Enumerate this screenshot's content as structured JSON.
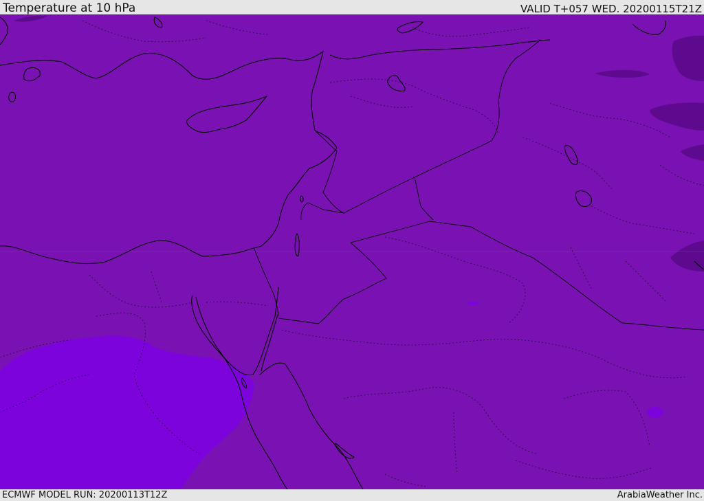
{
  "header": {
    "title": "Temperature at 10 hPa",
    "valid_time": "VALID T+057 WED. 20200115T21Z"
  },
  "footer": {
    "model_run": "ECMWF MODEL RUN: 20200113T12Z",
    "credit": "ArabiaWeather Inc."
  },
  "colors": {
    "base_fill": "#7a12b3",
    "warm_patch": "#7c03dc",
    "cold_patch": "#5e0a8f",
    "coastline": "#000000",
    "country_border": "#000000",
    "province_border": "#2a0a3a"
  }
}
